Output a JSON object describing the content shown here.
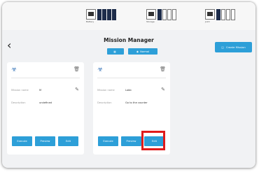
{
  "status_bar": {
    "items": [
      {
        "label": "Battery",
        "icon": "battery-icon",
        "bars_filled": 4,
        "bars_total": 4
      },
      {
        "label": "Storage",
        "icon": "storage-icon",
        "bars_filled": 1,
        "bars_total": 4
      },
      {
        "label": "Joint",
        "icon": "joint-icon",
        "bars_filled": 1,
        "bars_total": 4
      }
    ]
  },
  "header": {
    "back_icon": "chevron-left-icon",
    "title": "Mission Manager",
    "view_toggle_label": "",
    "mode_label": "Normal",
    "create_button_label": "Create Mission"
  },
  "missions": [
    {
      "name": "",
      "icon": "robot-icon",
      "fields": [
        {
          "label": "Mission name",
          "value": "M"
        },
        {
          "label": "Description",
          "value": "undefined"
        }
      ],
      "actions": [
        "Execute",
        "Preview",
        "Edit"
      ]
    },
    {
      "name": "",
      "icon": "robot-icon",
      "fields": [
        {
          "label": "Mission name",
          "value": "Lobb"
        },
        {
          "label": "Description",
          "value": "Go to the counter"
        }
      ],
      "actions": [
        "Execute",
        "Preview",
        "Edit"
      ]
    }
  ],
  "colors": {
    "accent": "#2d9fd8",
    "highlight": "#e01b1b",
    "background": "#f1f2f4",
    "card": "#ffffff"
  }
}
